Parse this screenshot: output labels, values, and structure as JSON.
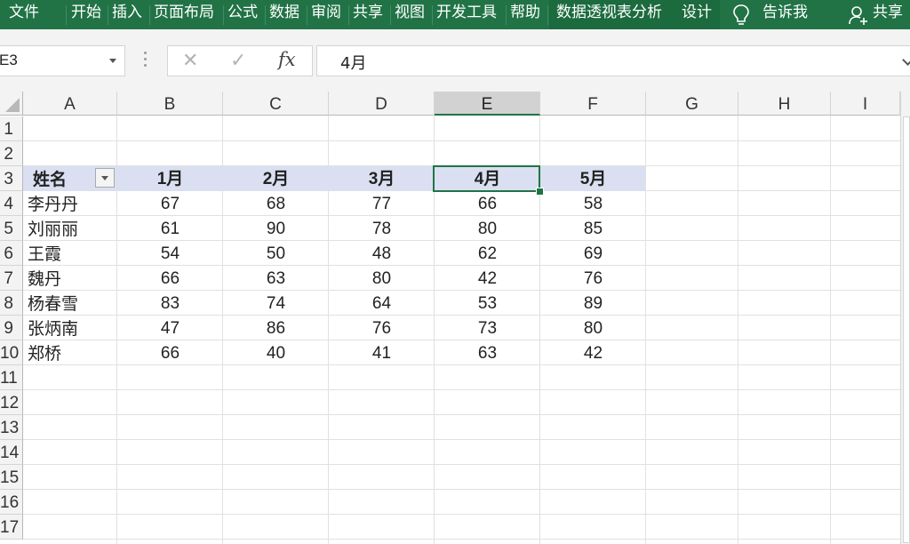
{
  "ribbon": {
    "tabs": [
      "文件",
      "开始",
      "插入",
      "页面布局",
      "公式",
      "数据",
      "审阅",
      "共享",
      "视图",
      "开发工具",
      "帮助",
      "数据透视表分析",
      "设计"
    ],
    "tellme": "告诉我",
    "share": "共享"
  },
  "formula_bar": {
    "name_box": "E3",
    "fx_label": "fx",
    "content": "4月"
  },
  "columns": [
    "A",
    "B",
    "C",
    "D",
    "E",
    "F",
    "G",
    "H",
    "I"
  ],
  "rows": [
    "1",
    "2",
    "3",
    "4",
    "5",
    "6",
    "7",
    "8",
    "9",
    "10",
    "11",
    "12",
    "13",
    "14",
    "15",
    "16",
    "17"
  ],
  "table": {
    "headers": [
      "姓名",
      "1月",
      "2月",
      "3月",
      "4月",
      "5月"
    ],
    "rows": [
      [
        "李丹丹",
        "67",
        "68",
        "77",
        "66",
        "58"
      ],
      [
        "刘丽丽",
        "61",
        "90",
        "78",
        "80",
        "85"
      ],
      [
        "王霞",
        "54",
        "50",
        "48",
        "62",
        "69"
      ],
      [
        "魏丹",
        "66",
        "63",
        "80",
        "42",
        "76"
      ],
      [
        "杨春雪",
        "83",
        "74",
        "64",
        "53",
        "89"
      ],
      [
        "张炳南",
        "47",
        "86",
        "76",
        "73",
        "80"
      ],
      [
        "郑桥",
        "66",
        "40",
        "41",
        "63",
        "42"
      ]
    ]
  },
  "colors": {
    "ribbon": "#217346",
    "header_row_fill": "#dae0f1"
  }
}
